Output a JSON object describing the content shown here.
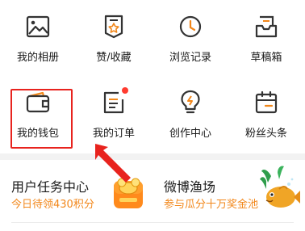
{
  "grid": [
    {
      "label": "我的相册",
      "icon": "photo-album-icon"
    },
    {
      "label": "赞/收藏",
      "icon": "favorites-badge-icon"
    },
    {
      "label": "浏览记录",
      "icon": "clock-history-icon"
    },
    {
      "label": "草稿箱",
      "icon": "drafts-tray-icon"
    },
    {
      "label": "我的钱包",
      "icon": "wallet-icon"
    },
    {
      "label": "我的订单",
      "icon": "orders-list-icon",
      "badge_dot": true
    },
    {
      "label": "创作中心",
      "icon": "lightbulb-icon"
    },
    {
      "label": "粉丝头条",
      "icon": "calendar-headline-icon"
    }
  ],
  "cards": {
    "task_center": {
      "title": "用户任务中心",
      "subtitle": "今日待领430积分",
      "icon": "coin-gift-icon"
    },
    "fishing": {
      "title": "微博渔场",
      "subtitle": "参与瓜分十万奖金池",
      "icon": "goldfish-icon"
    }
  },
  "colors": {
    "accent": "#f2871a",
    "highlight": "#e8231e",
    "icon_stroke": "#333333"
  }
}
